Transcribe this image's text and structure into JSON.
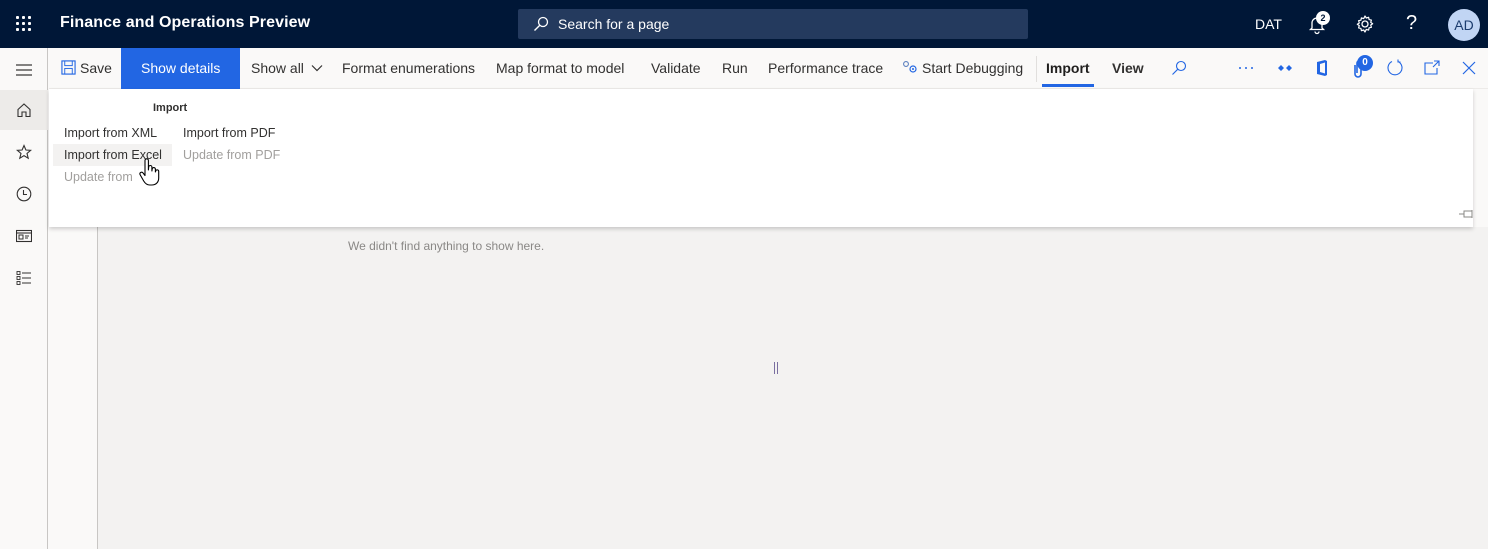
{
  "topbar": {
    "app_title": "Finance and Operations Preview",
    "search_placeholder": "Search for a page",
    "company": "DAT",
    "notification_count": "2",
    "help_glyph": "?",
    "avatar_initials": "AD",
    "icons": [
      "waffle-icon",
      "search-icon",
      "bell-icon",
      "gear-icon",
      "help-icon"
    ]
  },
  "leftnav": {
    "items": [
      {
        "name": "hamburger-menu",
        "icon": "menu-icon"
      },
      {
        "name": "home",
        "icon": "home-icon",
        "active": true
      },
      {
        "name": "favorites",
        "icon": "star-icon"
      },
      {
        "name": "recent",
        "icon": "clock-icon"
      },
      {
        "name": "workspaces",
        "icon": "workspace-icon"
      },
      {
        "name": "modules",
        "icon": "list-icon"
      }
    ]
  },
  "actionpane": {
    "save": "Save",
    "show_details": "Show details",
    "show_all": "Show all",
    "format_enumerations": "Format enumerations",
    "map_format_to_model": "Map format to model",
    "validate": "Validate",
    "run": "Run",
    "performance_trace": "Performance trace",
    "start_debugging": "Start Debugging",
    "import_tab": "Import",
    "view_tab": "View",
    "attachments_count": "0",
    "colors": {
      "primary": "#2266e3",
      "topbar": "#001737",
      "search_bg": "#243a5e"
    }
  },
  "ribbon": {
    "group_title": "Import",
    "column1": [
      {
        "label": "Import from XML",
        "enabled": true
      },
      {
        "label": "Import from Excel",
        "enabled": true,
        "hovered": true
      },
      {
        "label": "Update from Excel",
        "enabled": false,
        "visible_text": "Update from"
      }
    ],
    "column2": [
      {
        "label": "Import from PDF",
        "enabled": true
      },
      {
        "label": "Update from PDF",
        "enabled": false
      }
    ]
  },
  "content": {
    "empty_message": "We didn't find anything to show here."
  }
}
